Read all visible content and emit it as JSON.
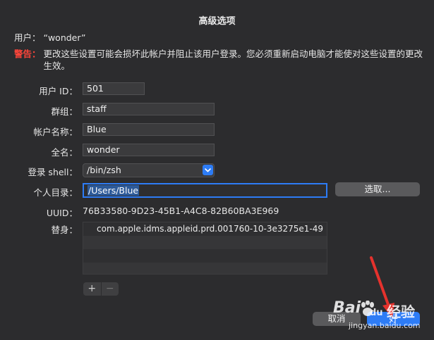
{
  "dialog": {
    "title": "高级选项",
    "user_line": "用户：  “wonder”",
    "warning_label": "警告：",
    "warning_text": "更改这些设置可能会损坏此帐户并阻止该用户登录。您必须重新启动电脑才能使对这些设置的更改生效。"
  },
  "fields": {
    "user_id_label": "用户 ID：",
    "user_id_value": "501",
    "group_label": "群组：",
    "group_value": "staff",
    "account_name_label": "帐户名称：",
    "account_name_value": "Blue",
    "full_name_label": "全名：",
    "full_name_value": "wonder",
    "login_shell_label": "登录 shell：",
    "login_shell_value": "/bin/zsh",
    "home_dir_label": "个人目录：",
    "home_dir_value": "/Users/Blue",
    "choose_button": "选取...",
    "uuid_label": "UUID：",
    "uuid_value": "76B33580-9D23-45B1-A4C8-82B60BA3E969",
    "aliases_label": "替身："
  },
  "aliases": [
    "com.apple.idms.appleid.prd.001760-10-3e3275e1-49",
    "",
    "",
    ""
  ],
  "list_controls": {
    "add": "+",
    "remove": "−"
  },
  "buttons": {
    "cancel": "取消",
    "ok": "好"
  },
  "watermark": {
    "brand": "Bai",
    "brand2": "du",
    "brand3": "经验",
    "url": "jingyan.baidu.com"
  },
  "colors": {
    "accent": "#2d7cf6",
    "warning": "#ff453a",
    "annotation_arrow": "#e5322d"
  },
  "icons": {
    "select_arrow": "chevron-down-icon"
  }
}
